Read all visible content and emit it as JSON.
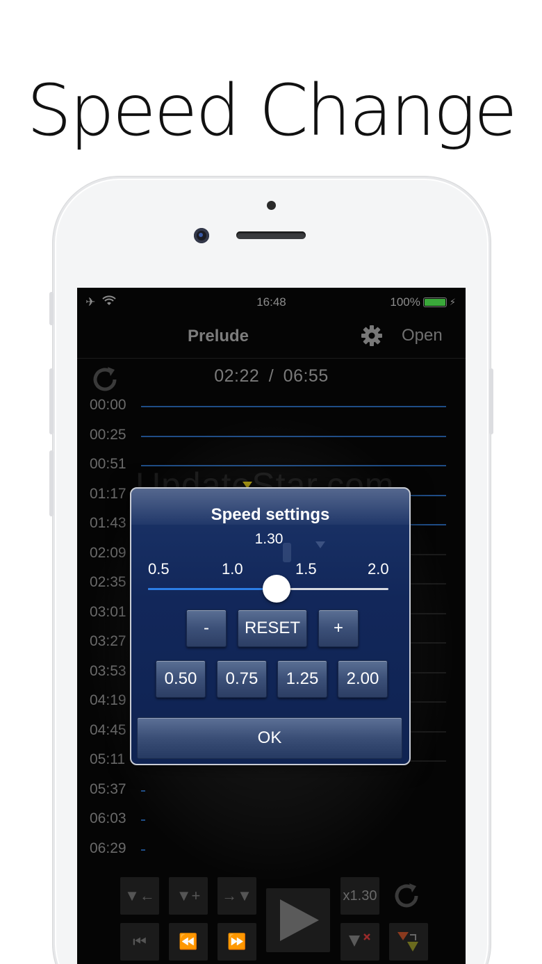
{
  "headline": "Speed Change",
  "status_bar": {
    "time": "16:48",
    "battery": "100%",
    "battery_level": 1.0
  },
  "navbar": {
    "title": "Prelude",
    "open_label": "Open"
  },
  "player": {
    "current_time": "02:22",
    "separator": "/",
    "total_time": "06:55"
  },
  "timeline": [
    {
      "label": "00:00",
      "line": "full"
    },
    {
      "label": "00:25",
      "line": "full"
    },
    {
      "label": "00:51",
      "line": "full"
    },
    {
      "label": "01:17",
      "line": "full"
    },
    {
      "label": "01:43",
      "line": "full"
    },
    {
      "label": "02:09",
      "line": "dim"
    },
    {
      "label": "02:35",
      "line": "dim"
    },
    {
      "label": "03:01",
      "line": "dim"
    },
    {
      "label": "03:27",
      "line": "dim"
    },
    {
      "label": "03:53",
      "line": "dim"
    },
    {
      "label": "04:19",
      "line": "dim"
    },
    {
      "label": "04:45",
      "line": "dim"
    },
    {
      "label": "05:11",
      "line": "dim"
    },
    {
      "label": "05:37",
      "line": "tick"
    },
    {
      "label": "06:03",
      "line": "tick"
    },
    {
      "label": "06:29",
      "line": "tick"
    }
  ],
  "watermark": "UpdateStar.com",
  "speed_dialog": {
    "title": "Speed settings",
    "value": "1.30",
    "slider": {
      "min": 0.5,
      "max": 2.0,
      "value": 1.3
    },
    "scale_labels": [
      "0.5",
      "1.0",
      "1.5",
      "2.0"
    ],
    "minus_label": "-",
    "reset_label": "RESET",
    "plus_label": "+",
    "presets": [
      "0.50",
      "0.75",
      "1.25",
      "2.00"
    ],
    "ok_label": "OK"
  },
  "controls": {
    "speed_badge": "x1.30"
  },
  "colors": {
    "dialog_bg": "#12275a",
    "slider_fill": "#2c7ee6",
    "timeline_line": "#1f4d86",
    "battery_green": "#3aa83a"
  }
}
